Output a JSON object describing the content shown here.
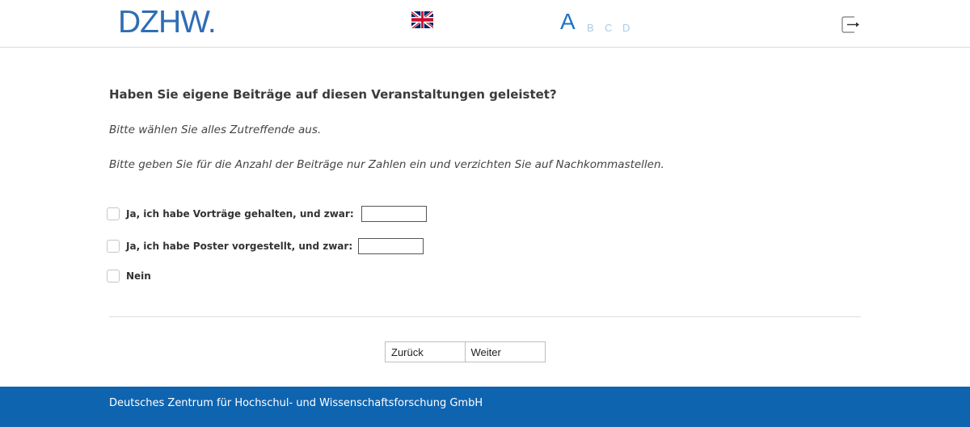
{
  "header": {
    "logo_text": "DZHW",
    "logo_dot": ".",
    "language_flag": "uk-flag-icon",
    "pager": {
      "current": "A",
      "others": [
        "B",
        "C",
        "D"
      ]
    },
    "exit_icon": "logout-icon"
  },
  "question": {
    "title": "Haben Sie eigene Beiträge auf diesen Veranstaltungen geleistet?",
    "hint1": "Bitte wählen Sie alles Zutreffende aus.",
    "hint2": "Bitte geben Sie für die Anzahl der Beiträge nur Zahlen ein und verzichten Sie auf Nachkommastellen.",
    "options": [
      {
        "label": "Ja, ich habe Vorträge gehalten, und zwar:",
        "value": "",
        "checked": false
      },
      {
        "label": "Ja, ich habe Poster vorgestellt, und zwar:",
        "value": "",
        "checked": false
      },
      {
        "label": "Nein",
        "checked": false
      }
    ]
  },
  "navigation": {
    "back_label": "Zurück",
    "next_label": "Weiter"
  },
  "footer": {
    "text": "Deutsches Zentrum für Hochschul- und Wissenschaftsforschung GmbH"
  },
  "colors": {
    "brand": "#2f6db3",
    "footer_bg": "#0f64b0",
    "pager_active": "#1a73c4",
    "pager_inactive": "#a9cce8"
  }
}
